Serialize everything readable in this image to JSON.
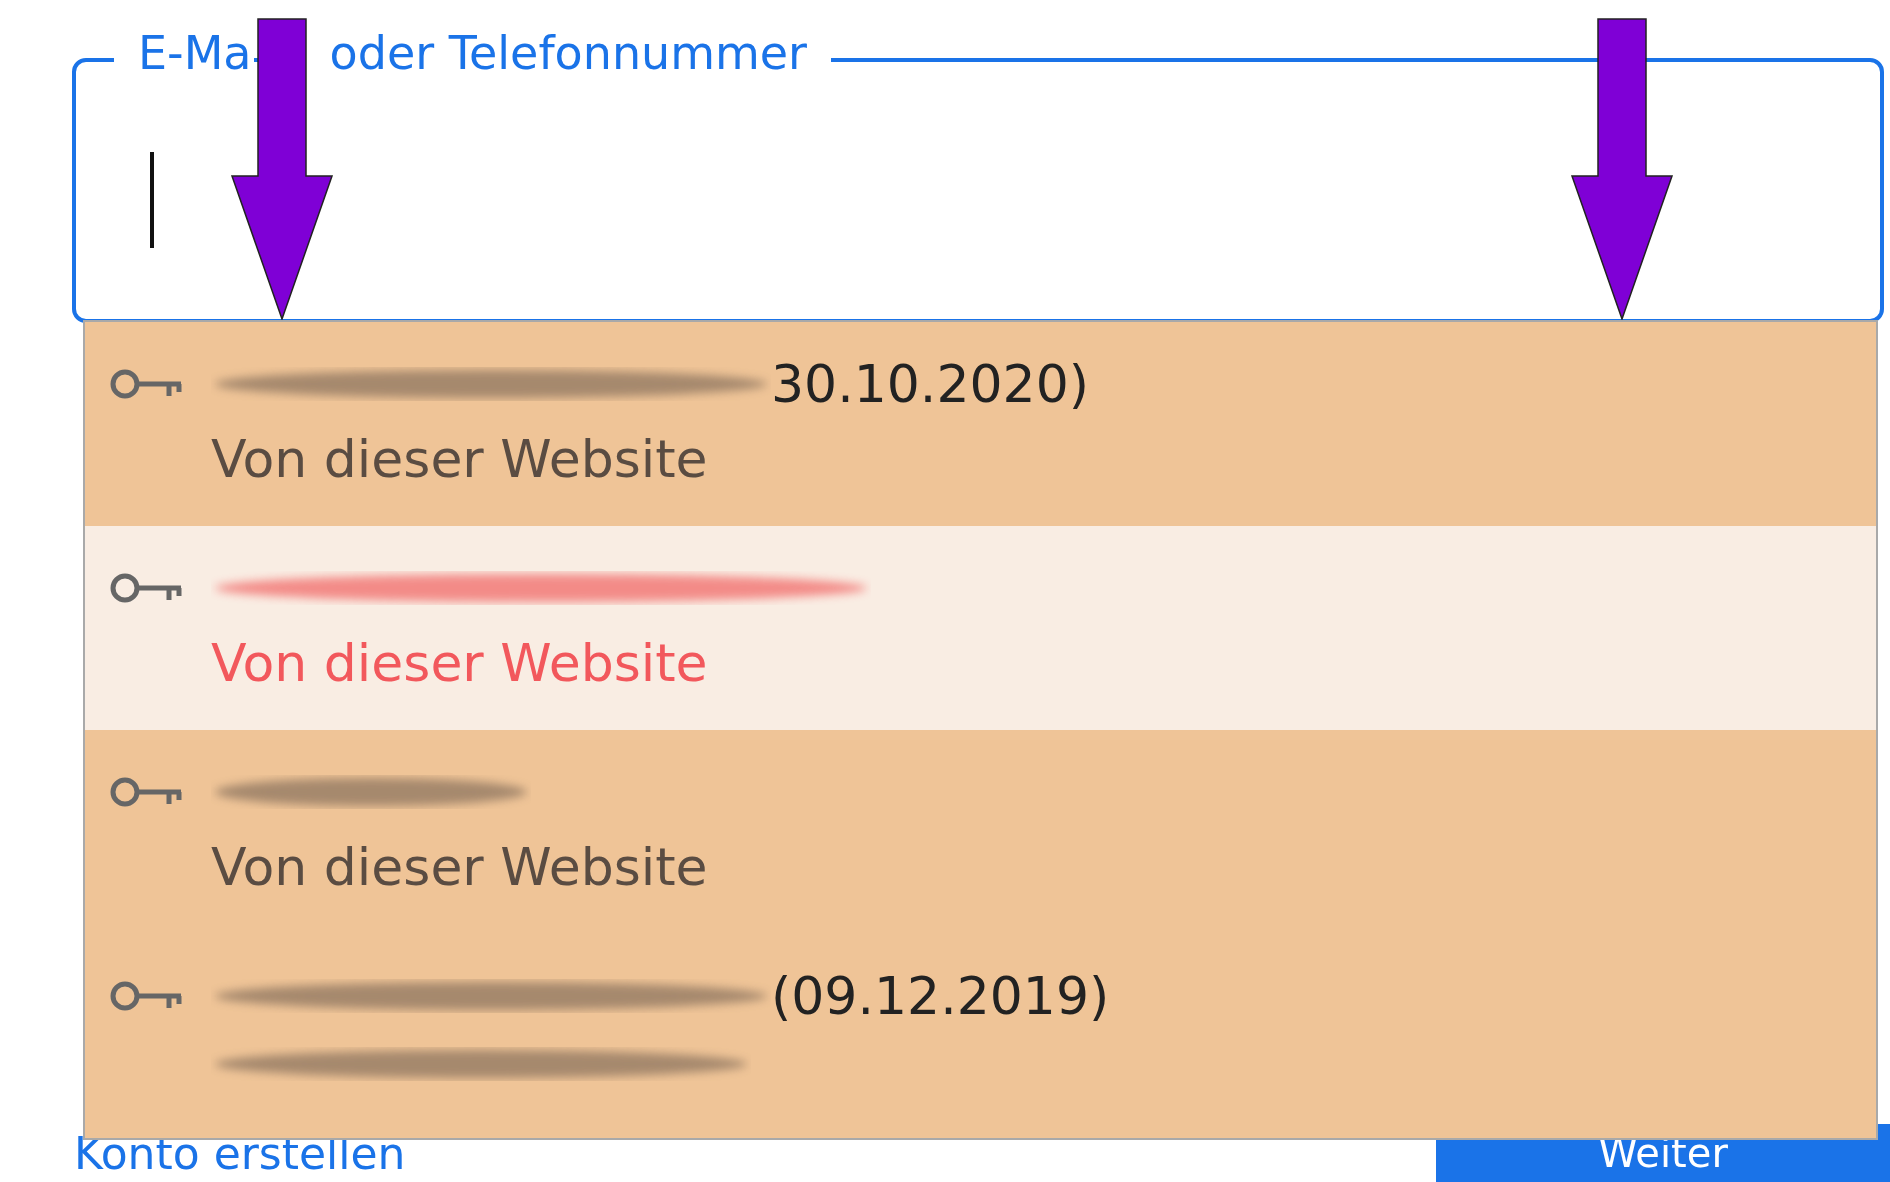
{
  "field": {
    "label_parts": [
      "E-Ma",
      "oder Telefonnummer"
    ],
    "focused": true
  },
  "suggestions": [
    {
      "date": "30.10.2020)",
      "subtitle": "Von dieser Website",
      "selected": false
    },
    {
      "subtitle": "Von dieser Website",
      "selected": true
    },
    {
      "subtitle": "Von dieser Website",
      "selected": false
    },
    {
      "date": "(09.12.2019)",
      "selected": false
    }
  ],
  "create_account_link": "Konto erstellen",
  "next_button": "Weiter"
}
